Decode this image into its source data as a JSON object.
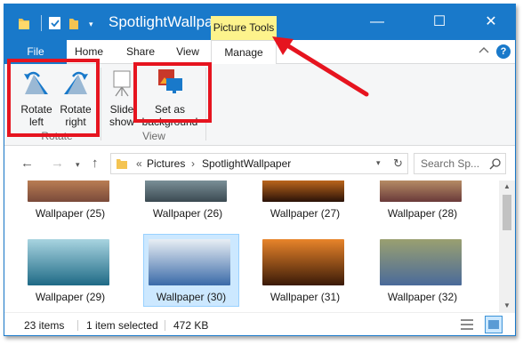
{
  "titlebar": {
    "title": "SpotlightWallpaper",
    "context_tab": "Picture Tools",
    "minimize": "—",
    "maximize": "☐",
    "close": "✕"
  },
  "tabs": {
    "file": "File",
    "home": "Home",
    "share": "Share",
    "view": "View",
    "manage": "Manage"
  },
  "ribbon": {
    "rotate_left_1": "Rotate",
    "rotate_left_2": "left",
    "rotate_right_1": "Rotate",
    "rotate_right_2": "right",
    "slideshow_1": "Slide",
    "slideshow_2": "show",
    "set_bg_1": "Set as",
    "set_bg_2": "background",
    "group_rotate": "Rotate",
    "group_view": "View"
  },
  "address": {
    "prefix": "«",
    "parts": [
      "Pictures",
      "SpotlightWallpaper"
    ],
    "separator": "›",
    "search_placeholder": "Search Sp..."
  },
  "files": [
    {
      "name": "Wallpaper (25)",
      "colors": [
        "#7a4a3a",
        "#c98a5a"
      ]
    },
    {
      "name": "Wallpaper (26)",
      "colors": [
        "#3b4a52",
        "#8aa0a8"
      ]
    },
    {
      "name": "Wallpaper (27)",
      "colors": [
        "#2a1208",
        "#e07a20"
      ]
    },
    {
      "name": "Wallpaper (28)",
      "colors": [
        "#6a3a3a",
        "#c8a070"
      ]
    },
    {
      "name": "Wallpaper (29)",
      "colors": [
        "#1f6a86",
        "#a8d4e0"
      ]
    },
    {
      "name": "Wallpaper (30)",
      "colors": [
        "#3a6aa8",
        "#e8eef4"
      ]
    },
    {
      "name": "Wallpaper (31)",
      "colors": [
        "#3a1a08",
        "#e8842a"
      ]
    },
    {
      "name": "Wallpaper (32)",
      "colors": [
        "#4a6a9a",
        "#9aa070"
      ]
    }
  ],
  "status": {
    "count": "23 items",
    "selected": "1 item selected",
    "size": "472 KB"
  },
  "colors": {
    "accent": "#1979ca",
    "highlight": "#e6141f",
    "picture_tools": "#fdf38c",
    "selection": "#cce8ff"
  }
}
